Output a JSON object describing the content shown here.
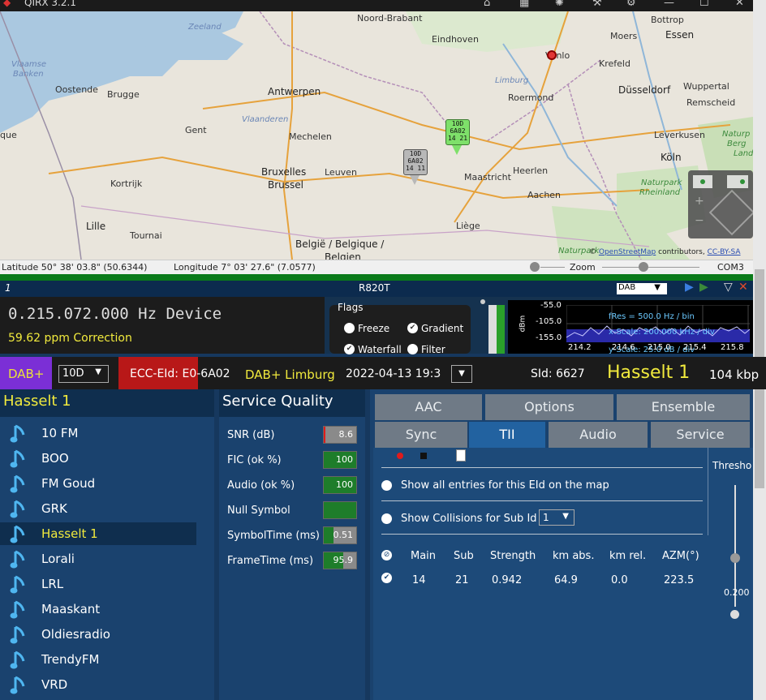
{
  "app": {
    "title": "QIRX 3.2.1"
  },
  "map": {
    "labels": {
      "noord_brabant": "Noord-Brabant",
      "zeeland": "Zeeland",
      "eindhoven": "Eindhoven",
      "venlo": "Venlo",
      "bottrop": "Bottrop",
      "moers": "Moers",
      "essen": "Essen",
      "krefeld": "Krefeld",
      "vlaamse": "Vlaamse",
      "banken": "Banken",
      "oostende": "Oostende",
      "brugge": "Brugge",
      "antwerpen": "Antwerpen",
      "limburg": "Limburg",
      "roermond": "Roermond",
      "dusseldorf": "Düsseldorf",
      "wuppertal": "Wuppertal",
      "remscheid": "Remscheid",
      "vlaanderen": "Vlaanderen",
      "gent": "Gent",
      "mechelen": "Mechelen",
      "leverkusen": "Leverkusen",
      "naturpark": "Naturp",
      "bergisches": "Berg",
      "land": "Land",
      "que": "que",
      "bruxelles": "Bruxelles",
      "brussel": "Brussel",
      "leuven": "Leuven",
      "maastricht": "Maastricht",
      "heerlen": "Heerlen",
      "koln": "Köln",
      "kortrijk": "Kortrijk",
      "aachen": "Aachen",
      "naturpark_rh": "Naturpark",
      "rheinland": "Rheinland",
      "lille": "Lille",
      "tournai": "Tournai",
      "liege": "Liège",
      "belgie": "België / Belgique /",
      "belgien": "Belgien",
      "naturpark2": "Naturpark"
    },
    "markers": [
      {
        "color": "#7ee06a",
        "lines": [
          "10D",
          "6A02",
          "14 21"
        ]
      },
      {
        "color": "#b8b8b8",
        "lines": [
          "10D",
          "6A02",
          "14 11"
        ]
      }
    ],
    "attribution_pre": "©",
    "attribution_link": "OpenStreetMap",
    "attribution_post": "contributors,",
    "attribution_cc": "CC-BY-SA",
    "status": {
      "latitude": "Latitude  50° 38' 03.8\" (50.6344)",
      "longitude": "Longitude  7° 03' 27.6\" (7.0577)",
      "zoom": "Zoom",
      "port": "COM3"
    }
  },
  "device": {
    "index": "1",
    "tuner": "R820T",
    "mode": "DAB",
    "frequency": "0.215.072.000 Hz Device",
    "correction": "59.62 ppm Correction",
    "flags": {
      "title": "Flags",
      "freeze": "Freeze",
      "gradient": "Gradient",
      "waterfall": "Waterfall",
      "filter": "Filter"
    },
    "spectrum": {
      "dbm": "dBm",
      "y_ticks": [
        "-55.0",
        "-105.0",
        "-155.0"
      ],
      "x_ticks": [
        "214.2",
        "214.6",
        "215.0",
        "215.4",
        "215.8"
      ],
      "fres": "fRes = 500.0 Hz / bin",
      "xscale": "x-Scale: 200.000 kHz / div",
      "yscale": "y-Scale: 25.0 dB / div"
    }
  },
  "service_bar": {
    "mode": "DAB+",
    "channel": "10D",
    "ecc": "ECC-EId: E0-6A02",
    "ensemble": "DAB+ Limburg",
    "datetime": "2022-04-13 19:3",
    "sid": "SId: 6627",
    "service": "Hasselt 1",
    "bitrate": "104 kbp"
  },
  "services": {
    "header": "Hasselt 1",
    "items": [
      {
        "label": "10 FM"
      },
      {
        "label": "BOO"
      },
      {
        "label": "FM Goud"
      },
      {
        "label": "GRK"
      },
      {
        "label": "Hasselt 1"
      },
      {
        "label": "Lorali"
      },
      {
        "label": "LRL"
      },
      {
        "label": "Maaskant"
      },
      {
        "label": "Oldiesradio"
      },
      {
        "label": "TrendyFM"
      },
      {
        "label": "VRD"
      }
    ]
  },
  "quality": {
    "title": "Service Quality",
    "rows": [
      {
        "label": "SNR (dB)",
        "value": "8.6",
        "fill": 0.06,
        "color": "#e01b1b"
      },
      {
        "label": "FIC (ok %)",
        "value": "100",
        "fill": 1.0,
        "color": "#1e7d2a"
      },
      {
        "label": "Audio (ok %)",
        "value": "100",
        "fill": 1.0,
        "color": "#1e7d2a"
      },
      {
        "label": "Null Symbol",
        "value": "",
        "fill": 1.0,
        "color": "#1e7d2a"
      },
      {
        "label": "SymbolTime (ms)",
        "value": "0.51",
        "fill": 0.3,
        "color": "#1e7d2a"
      },
      {
        "label": "FrameTime (ms)",
        "value": "95.9",
        "fill": 0.6,
        "color": "#1e7d2a"
      }
    ]
  },
  "tabs": {
    "row1": [
      "AAC",
      "Options",
      "Ensemble"
    ],
    "row2": [
      "Sync",
      "TII",
      "Audio",
      "Service"
    ]
  },
  "tii": {
    "show_all": "Show all entries for this EId on the map",
    "show_collisions": "Show Collisions for Sub Id",
    "collision_value": "1",
    "columns": [
      "Main",
      "Sub",
      "Strength",
      "km abs.",
      "km rel.",
      "AZM(°)"
    ],
    "rows": [
      {
        "main": "14",
        "sub": "21",
        "strength": "0.942",
        "km_abs": "64.9",
        "km_rel": "0.0",
        "azm": "223.5"
      }
    ],
    "threshold_label": "Thresho",
    "threshold_value": "0.200"
  }
}
